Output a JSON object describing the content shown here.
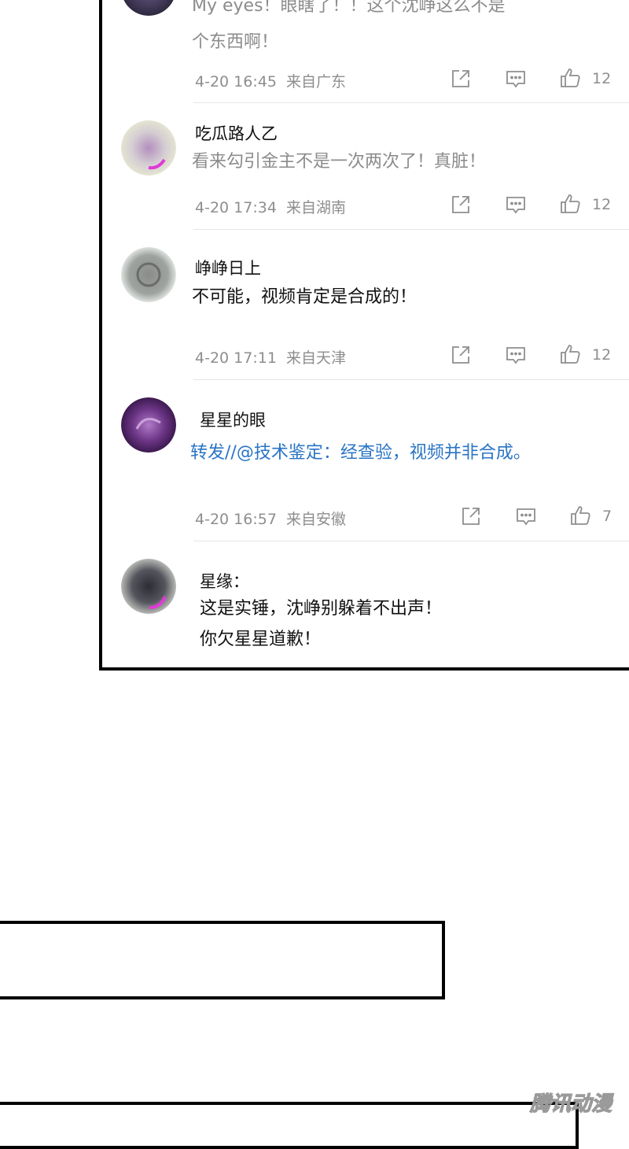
{
  "comments": [
    {
      "username": "",
      "text_line1": "My eyes！眼瞎了！！这个沈峥这么不是",
      "text_line2": "个东西啊！",
      "time": "4-20 16:45",
      "location": "来自广东",
      "likes": "12",
      "avatar_colors": [
        "#3b3550",
        "#6a5c88"
      ]
    },
    {
      "username": "吃瓜路人乙",
      "text": "看来勾引金主不是一次两次了！真脏！",
      "time": "4-20 17:34",
      "location": "来自湖南",
      "likes": "12",
      "avatar_colors": [
        "#cfc7c9",
        "#a97fb4"
      ]
    },
    {
      "username": "峥峥日上",
      "text": "不可能，视频肯定是合成的！",
      "time": "4-20 17:11",
      "location": "来自天津",
      "likes": "12",
      "avatar_colors": [
        "#7d807d",
        "#bfc3bf"
      ]
    },
    {
      "username": "星星的眼",
      "text": "转发//@技术鉴定：经查验，视频并非合成。",
      "time": "4-20 16:57",
      "location": "来自安徽",
      "likes": "7",
      "avatar_colors": [
        "#5d2d75",
        "#9a5fb0"
      ]
    },
    {
      "username": "星缘：",
      "text_line1": "这是实锤，沈峥别躲着不出声！",
      "text_line2": "你欠星星道歉！",
      "avatar_colors": [
        "#3a3a42",
        "#7e7e86"
      ]
    }
  ],
  "icons": {
    "share": "share-icon",
    "comment": "comment-icon",
    "like": "thumbs-up-icon"
  },
  "watermark": "腾讯动漫"
}
